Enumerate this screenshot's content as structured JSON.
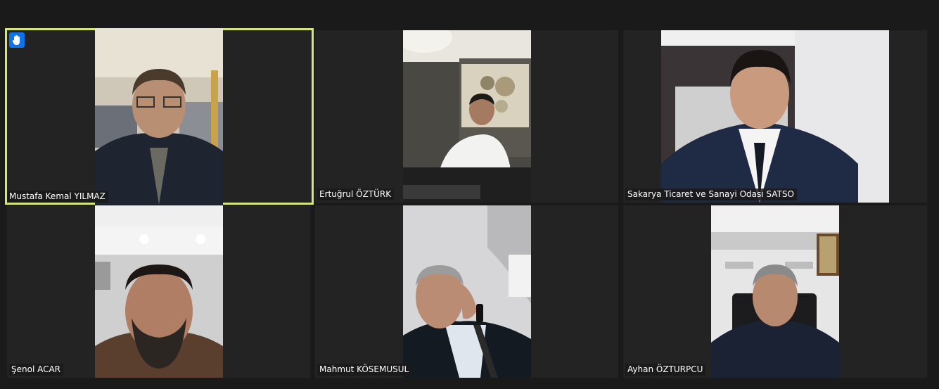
{
  "app": {
    "accent_color": "#d6e57a",
    "background_color": "#1a1a1a"
  },
  "participants": [
    {
      "name": "Mustafa Kemal YILMAZ",
      "active_speaker": true,
      "raised_hand": true,
      "raised_hand_icon": "raise-hand-icon"
    },
    {
      "name": "Ertuğrul ÖZTÜRK",
      "active_speaker": false,
      "raised_hand": false
    },
    {
      "name": "Sakarya Ticaret ve Sanayi Odası SATSO",
      "active_speaker": false,
      "raised_hand": false
    },
    {
      "name": "Şenol ACAR",
      "active_speaker": false,
      "raised_hand": false
    },
    {
      "name": "Mahmut KÖSEMUSUL",
      "active_speaker": false,
      "raised_hand": false
    },
    {
      "name": "Ayhan ÖZTURPCU",
      "active_speaker": false,
      "raised_hand": false
    }
  ]
}
